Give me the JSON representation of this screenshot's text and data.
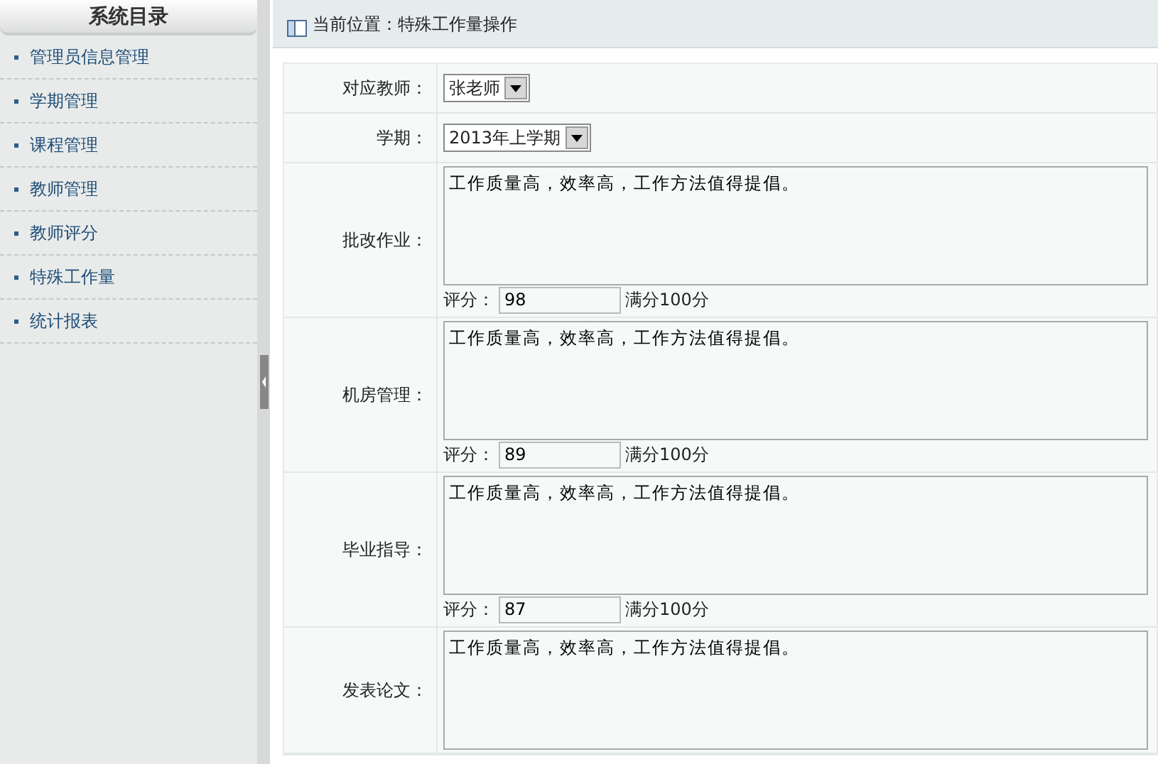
{
  "sidebar": {
    "title": "系统目录",
    "items": [
      {
        "label": "管理员信息管理"
      },
      {
        "label": "学期管理"
      },
      {
        "label": "课程管理"
      },
      {
        "label": "教师管理"
      },
      {
        "label": "教师评分"
      },
      {
        "label": "特殊工作量"
      },
      {
        "label": "统计报表"
      }
    ]
  },
  "breadcrumb": "当前位置：特殊工作量操作",
  "form": {
    "selects": [
      {
        "label": "对应教师：",
        "value": "张老师"
      },
      {
        "label": "学期：",
        "value": "2013年上学期"
      }
    ],
    "sections": [
      {
        "label": "批改作业：",
        "comment": "工作质量高，效率高，工作方法值得提倡。",
        "score_label": "评分：",
        "score": "98",
        "score_note": "满分100分"
      },
      {
        "label": "机房管理：",
        "comment": "工作质量高，效率高，工作方法值得提倡。",
        "score_label": "评分：",
        "score": "89",
        "score_note": "满分100分"
      },
      {
        "label": "毕业指导：",
        "comment": "工作质量高，效率高，工作方法值得提倡。",
        "score_label": "评分：",
        "score": "87",
        "score_note": "满分100分"
      },
      {
        "label": "发表论文：",
        "comment": "工作质量高，效率高，工作方法值得提倡。"
      }
    ]
  }
}
